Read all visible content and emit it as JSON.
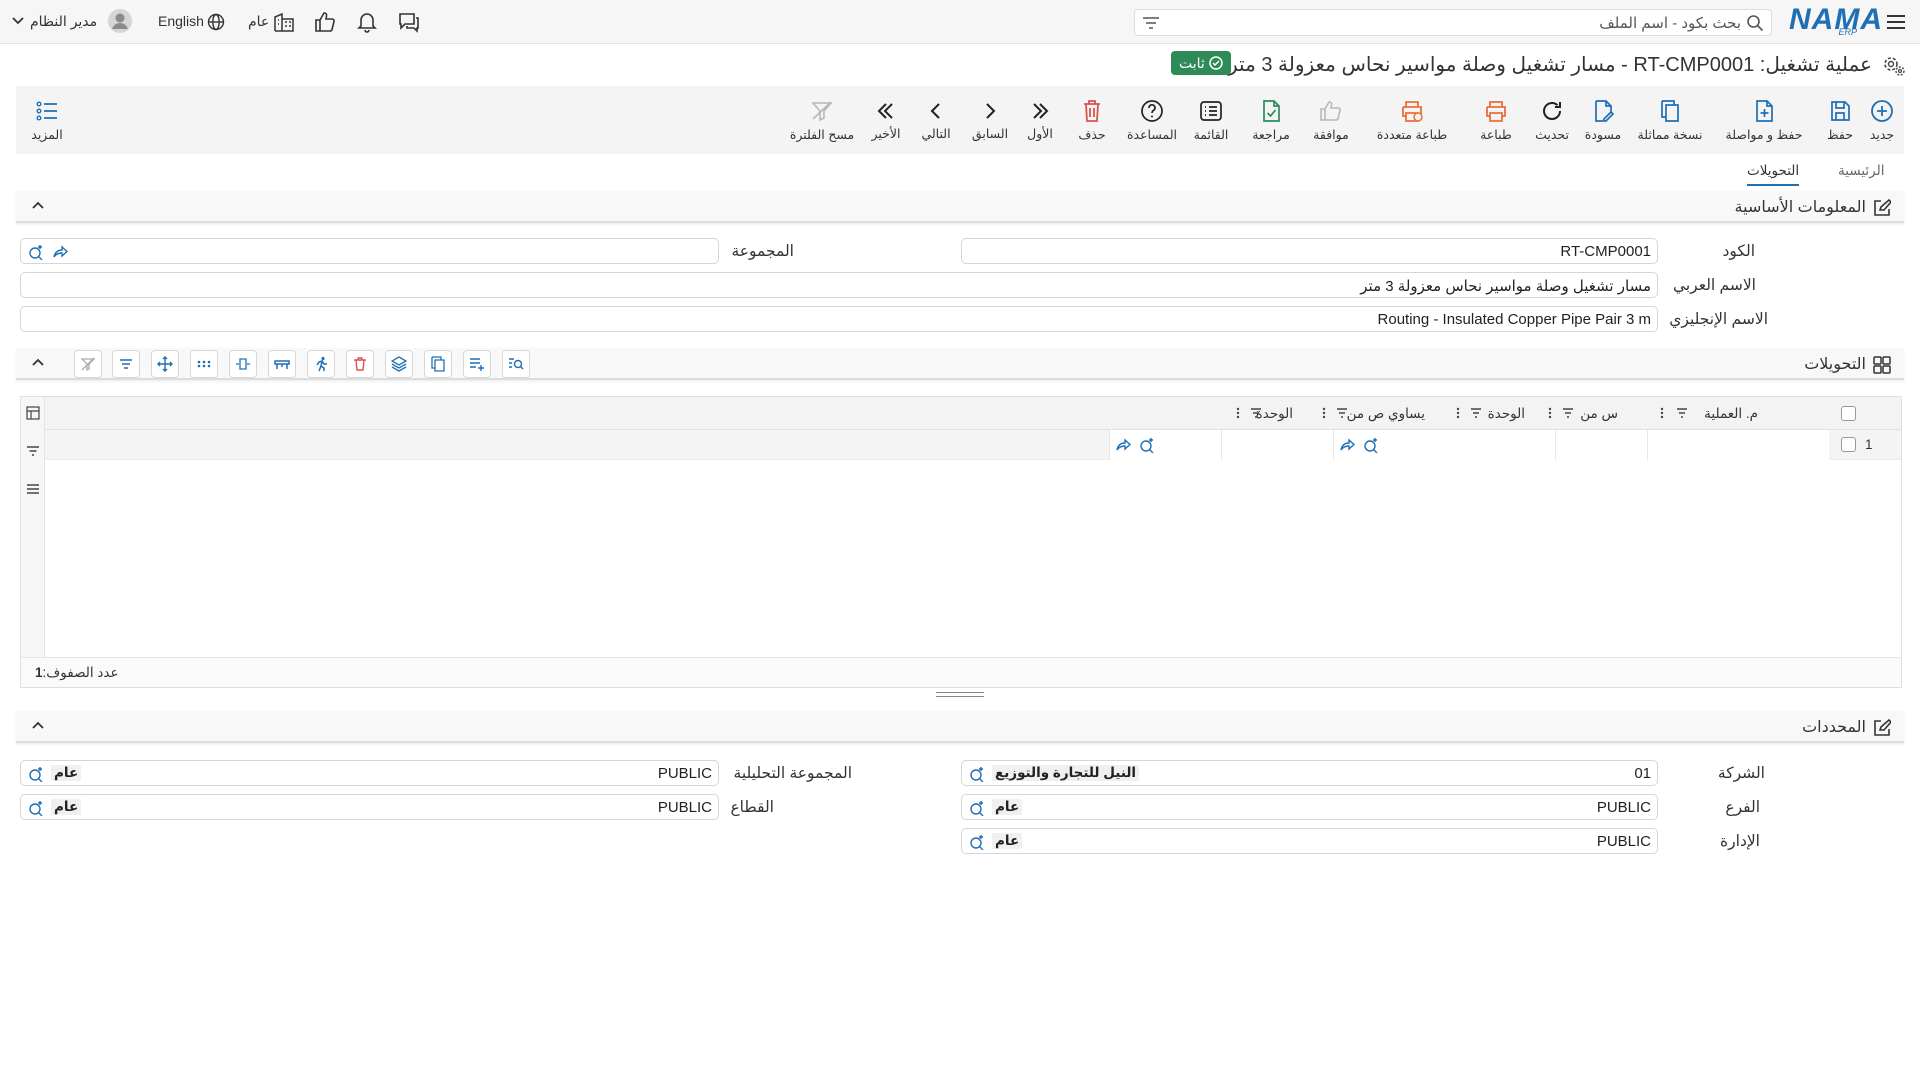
{
  "topbar": {
    "logo_text": "NAMA",
    "logo_sub": "ERP",
    "search_placeholder": "بحث بكود - اسم الملف",
    "user_label": "مدير النظام",
    "language_label": "English",
    "company_label": "عام"
  },
  "title": {
    "text": "عملية تشغيل: RT-CMP0001 - مسار تشغيل وصلة مواسير نحاس معزولة 3 متر",
    "badge": "ثابت"
  },
  "toolbar": {
    "new": "جديد",
    "save": "حفظ",
    "save_continue": "حفظ و مواصلة",
    "duplicate": "نسخة مماثلة",
    "draft": "مسودة",
    "refresh": "تحديث",
    "print": "طباعة",
    "multi_print": "طباعة متعددة",
    "approve": "موافقة",
    "review": "مراجعة",
    "list": "القائمة",
    "help": "المساعدة",
    "delete": "حذف",
    "first": "الأول",
    "previous": "السابق",
    "next": "التالي",
    "last": "الأخير",
    "clear_filter": "مسح الفلترة",
    "more": "المزيد"
  },
  "tabs": {
    "main": "الرئيسية",
    "conversions": "التحويلات"
  },
  "basic_info": {
    "title": "المعلومات الأساسية",
    "code_label": "الكود",
    "code_value": "RT-CMP0001",
    "group_label": "المجموعة",
    "group_value": "",
    "arabic_name_label": "الاسم العربي",
    "arabic_name_value": "مسار تشغيل وصلة مواسير نحاس معزولة 3 متر",
    "english_name_label": "الاسم الإنجليزي",
    "english_name_value": "Routing - Insulated Copper Pipe Pair 3 m"
  },
  "conversions": {
    "title": "التحويلات",
    "columns": [
      "م. العملية",
      "س من",
      "الوحدة",
      "يساوي ص من",
      "الوحدة"
    ],
    "rows": [
      {
        "num": "1"
      }
    ],
    "row_count_label": "عدد الصفوف:",
    "row_count_value": "1"
  },
  "determinants": {
    "title": "المحددات",
    "company_label": "الشركة",
    "company_code": "01",
    "company_name": "النيل للتجارة والتوزيع",
    "branch_label": "الفرع",
    "branch_code": "PUBLIC",
    "branch_name": "عام",
    "department_label": "الإدارة",
    "department_code": "PUBLIC",
    "department_name": "عام",
    "analytic_group_label": "المجموعة التحليلية",
    "analytic_group_code": "PUBLIC",
    "analytic_group_name": "عام",
    "sector_label": "القطاع",
    "sector_code": "PUBLIC",
    "sector_name": "عام"
  },
  "colors": {
    "brand": "#1f6fb5",
    "badge": "#2e8b57",
    "danger": "#d9534f",
    "print": "#e8703a"
  }
}
